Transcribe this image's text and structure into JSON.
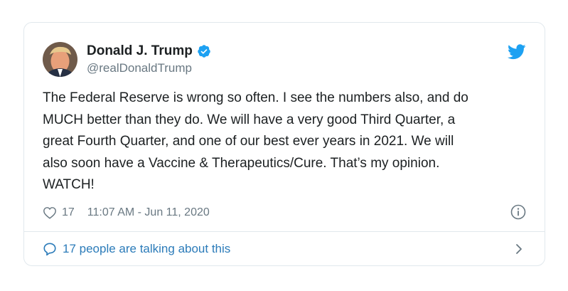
{
  "tweet": {
    "author": {
      "display_name": "Donald J. Trump",
      "handle": "@realDonaldTrump",
      "verified": true,
      "avatar_icon": "profile-photo"
    },
    "text": "The Federal Reserve is wrong so often. I see the numbers also, and do\nMUCH better than they do. We will have a very good Third Quarter, a\ngreat Fourth Quarter, and one of our best ever years in 2021. We will\nalso soon have a Vaccine & Therapeutics/Cure. That’s my opinion.\nWATCH!",
    "likes": "17",
    "timestamp": "11:07 AM - Jun 11, 2020",
    "talking_label": "17 people are talking about this",
    "icons": {
      "brand": "twitter-bird-icon",
      "verified": "verified-badge-icon",
      "like": "heart-icon",
      "info": "info-icon",
      "talking": "speech-bubble-icon",
      "more": "chevron-right-icon"
    },
    "colors": {
      "brand": "#1da1f2",
      "link": "#2b7bb9",
      "muted": "#697882",
      "text": "#1c2022",
      "border": "#e1e8ed"
    }
  }
}
